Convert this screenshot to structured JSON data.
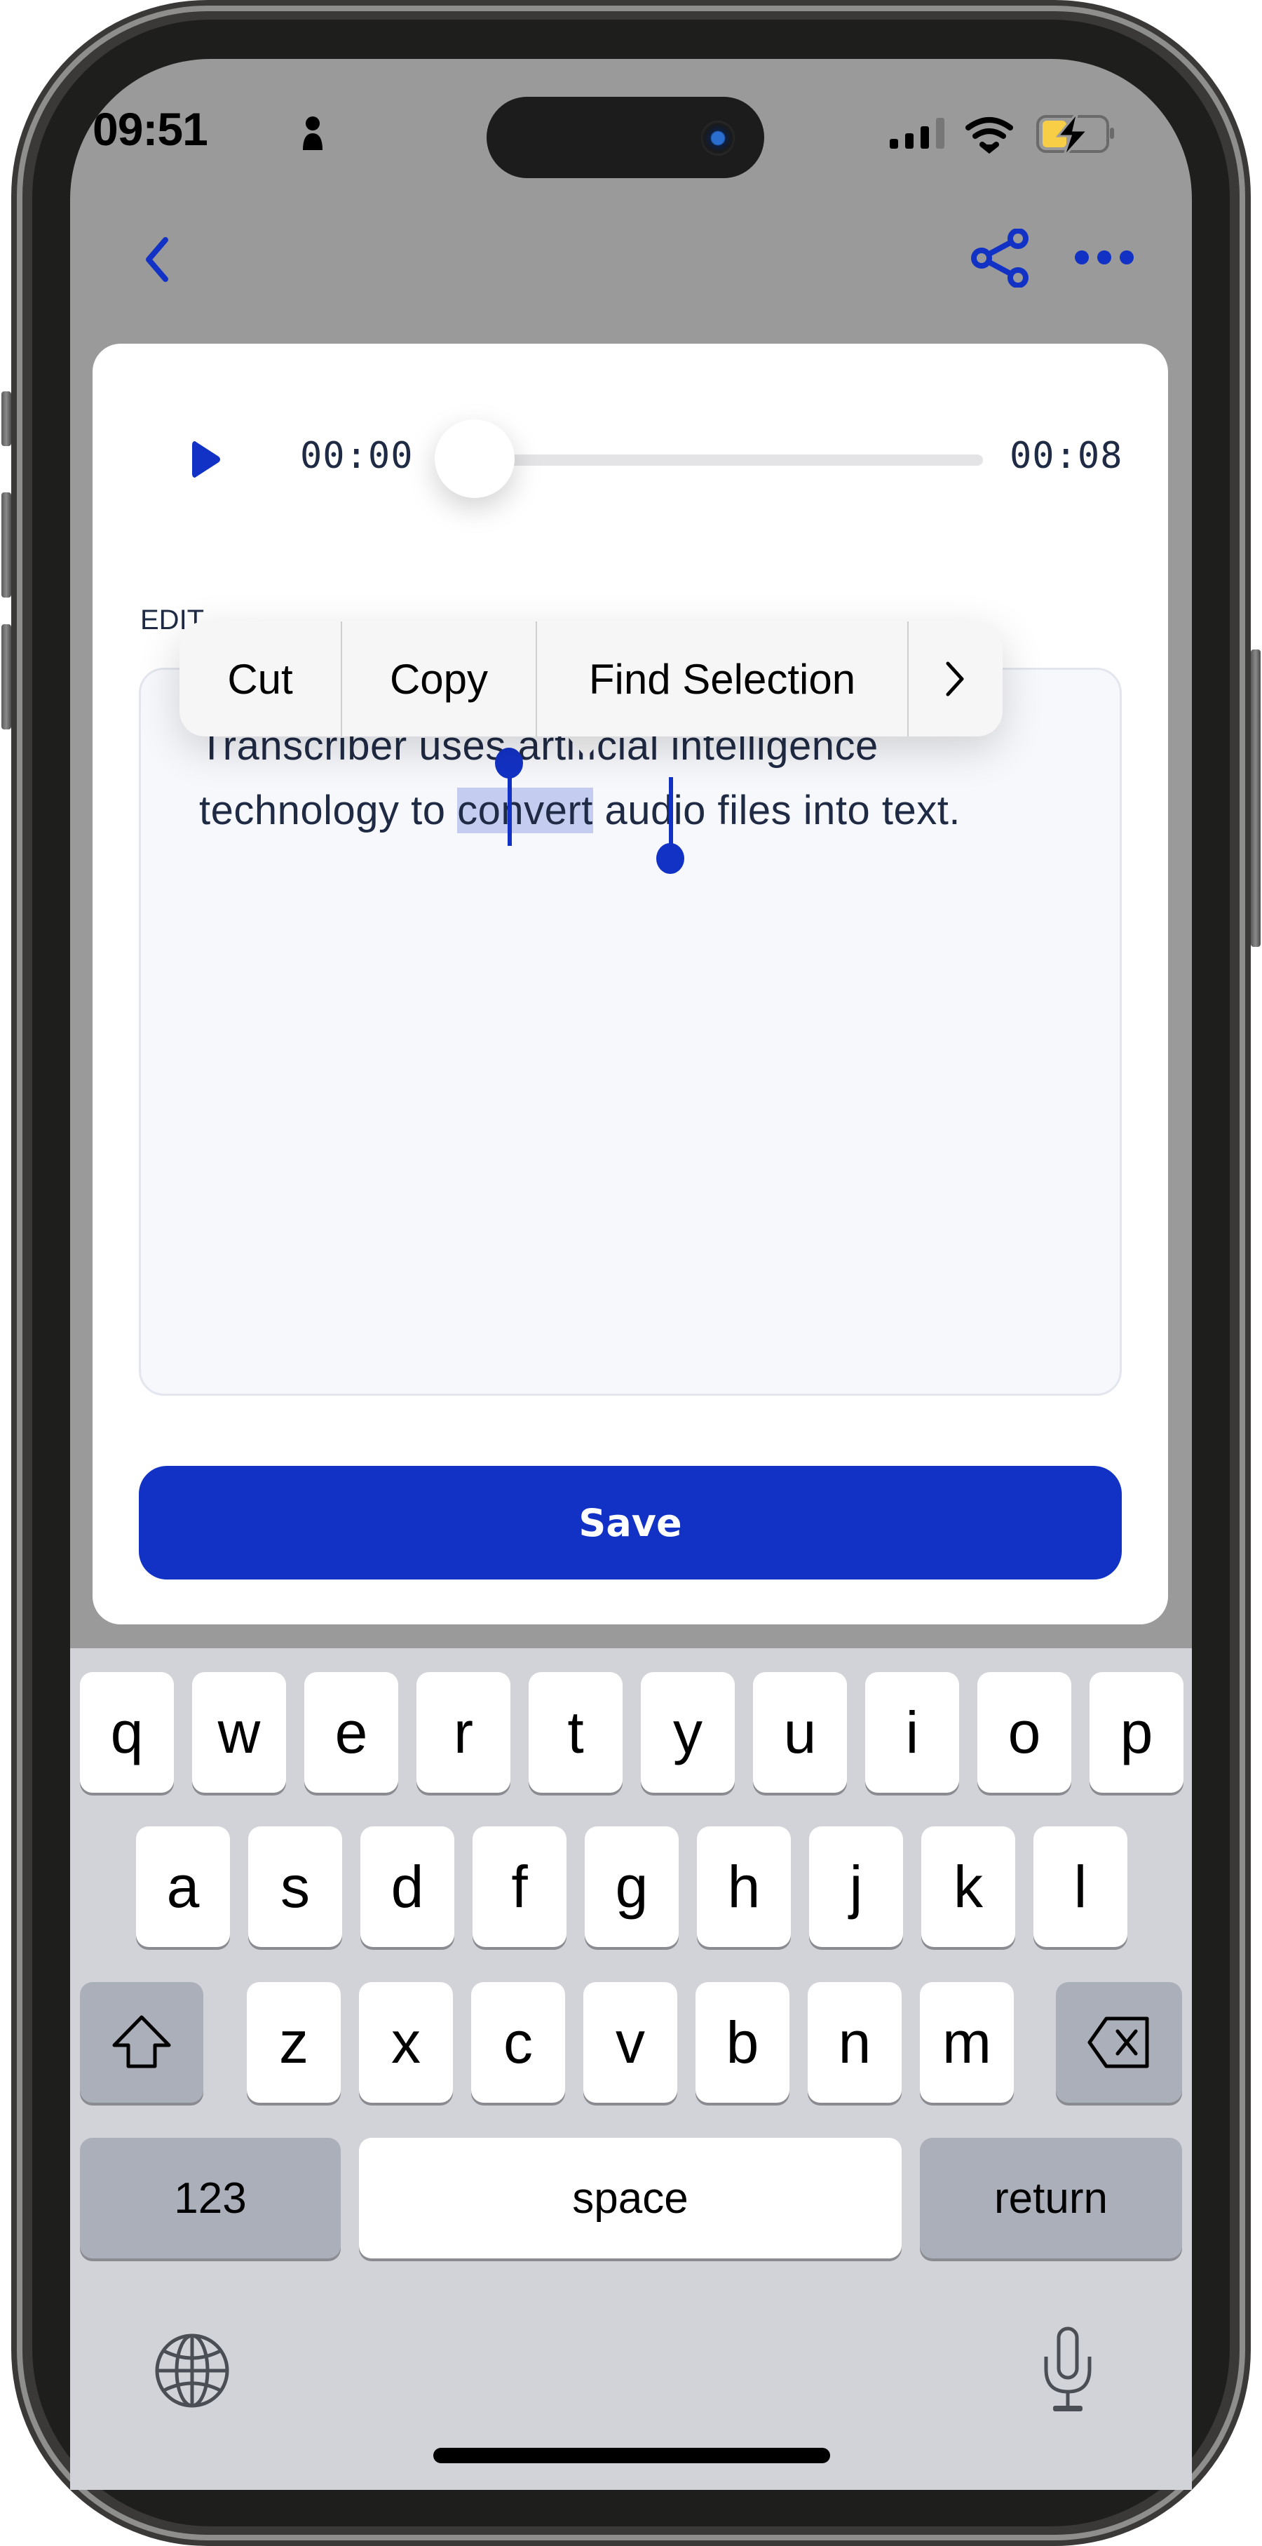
{
  "status_bar": {
    "time": "09:51",
    "icons": [
      "person-icon",
      "signal-icon",
      "wifi-icon",
      "battery-charging-icon"
    ],
    "battery_color": "#f8ce46"
  },
  "nav": {
    "back_icon": "chevron-left-icon",
    "share_icon": "share-icon",
    "more_icon": "ellipsis-icon",
    "accent": "#1232c6"
  },
  "player": {
    "current_time": "00:00",
    "duration": "00:08",
    "progress": 0
  },
  "editor": {
    "section_label": "EDIT",
    "text_before": "Transcriber uses artificial intelligence technology to ",
    "text_selected": "convert",
    "text_after": " audio files into text."
  },
  "context_menu": {
    "items": [
      "Cut",
      "Copy",
      "Find Selection"
    ],
    "more_icon": "chevron-right-icon"
  },
  "save_button": {
    "label": "Save"
  },
  "keyboard": {
    "row1": [
      "q",
      "w",
      "e",
      "r",
      "t",
      "y",
      "u",
      "i",
      "o",
      "p"
    ],
    "row2": [
      "a",
      "s",
      "d",
      "f",
      "g",
      "h",
      "j",
      "k",
      "l"
    ],
    "row3": [
      "z",
      "x",
      "c",
      "v",
      "b",
      "n",
      "m"
    ],
    "shift_icon": "shift-icon",
    "delete_icon": "delete-icon",
    "numbers_label": "123",
    "space_label": "space",
    "return_label": "return",
    "globe_icon": "globe-icon",
    "mic_icon": "microphone-icon"
  }
}
